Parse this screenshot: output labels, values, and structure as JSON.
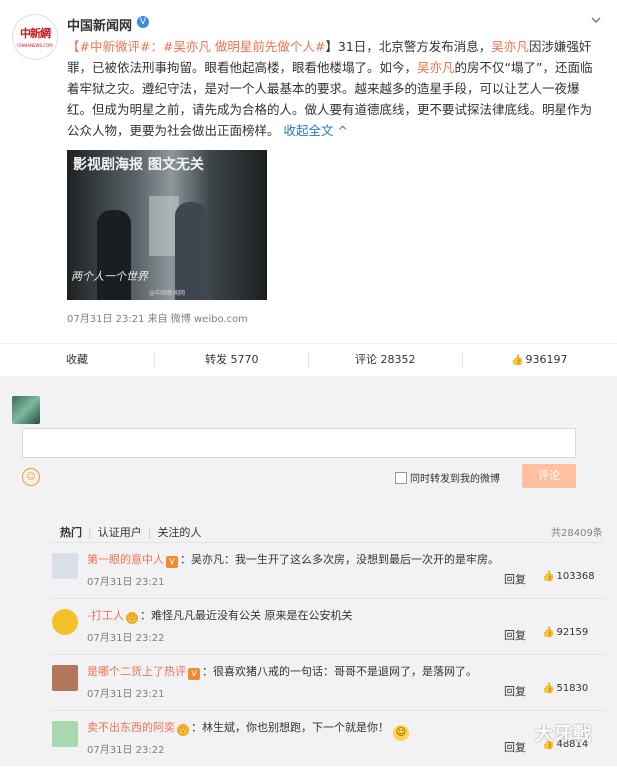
{
  "post": {
    "username": "中国新闻网",
    "avatar_logo_text": "中新網",
    "avatar_logo_sub": "CHINANEWS.COM",
    "text": {
      "tag1": "【#中新微评#：",
      "tag2": "#吴亦凡 做明星前先做个人#",
      "part1": "】31日，北京警方发布消息，",
      "name1": "吴亦凡",
      "part2": "因涉嫌强奸罪，已被依法刑事拘留。眼看他起高楼，眼看他楼塌了。如今，",
      "name2": "吴亦凡",
      "part3": "的房不仅“塌了”，还面临着牢狱之灾。遵纪守法，是对一个人最基本的要求。越来越多的造星手段，可以让艺人一夜爆红。但成为明星之前，请先成为合格的人。做人要有道德底线，更不要试探法律底线。明星作为公众人物，更要为社会做出正面榜样。",
      "fold_label": "收起全文",
      "fold_icon": "^"
    },
    "image": {
      "caption": "影视剧海报 图文无关",
      "script_text": "两个人一个世界",
      "watermark": "@中国新闻网"
    },
    "meta": "07月31日 23:21  来自 微博 weibo.com"
  },
  "actions": {
    "collect": "收藏",
    "forward": "转发 5770",
    "comment": "评论 28352",
    "like": "936197"
  },
  "composer": {
    "forward_label": "同时转发到我的微博",
    "submit_label": "评论"
  },
  "filters": {
    "hot": "热门",
    "verified": "认证用户",
    "following": "关注的人",
    "total": "共28409条"
  },
  "comments": [
    {
      "user": "第一眼的意中人",
      "badge": "V",
      "text": "：吴亦凡：我一生开了这么多次房，没想到最后一次开的是牢房。",
      "time": "07月31日 23:21",
      "reply": "回复",
      "likes": "103368",
      "avatar_color": "#d9dfe8"
    },
    {
      "user": "-打工人",
      "badge": "👑",
      "text": "：难怪凡凡最近没有公关 原来是在公安机关",
      "time": "07月31日 23:22",
      "reply": "回复",
      "likes": "92159",
      "avatar_color": "#f3c12a"
    },
    {
      "user": "是哪个二货上了热评",
      "badge": "V",
      "text": "：很喜欢猪八戒的一句话：哥哥不是退网了，是落网了。",
      "time": "07月31日 23:21",
      "reply": "回复",
      "likes": "51830",
      "avatar_color": "#b3775a"
    },
    {
      "user": "卖不出东西的阿奕",
      "badge": "👑",
      "text": "：林生斌，你也别想跑，下一个就是你！",
      "time": "07月31日 23:22",
      "reply": "回复",
      "likes": "48814",
      "avatar_color": "#a8d8b0"
    }
  ],
  "watermark": "大牙戰"
}
